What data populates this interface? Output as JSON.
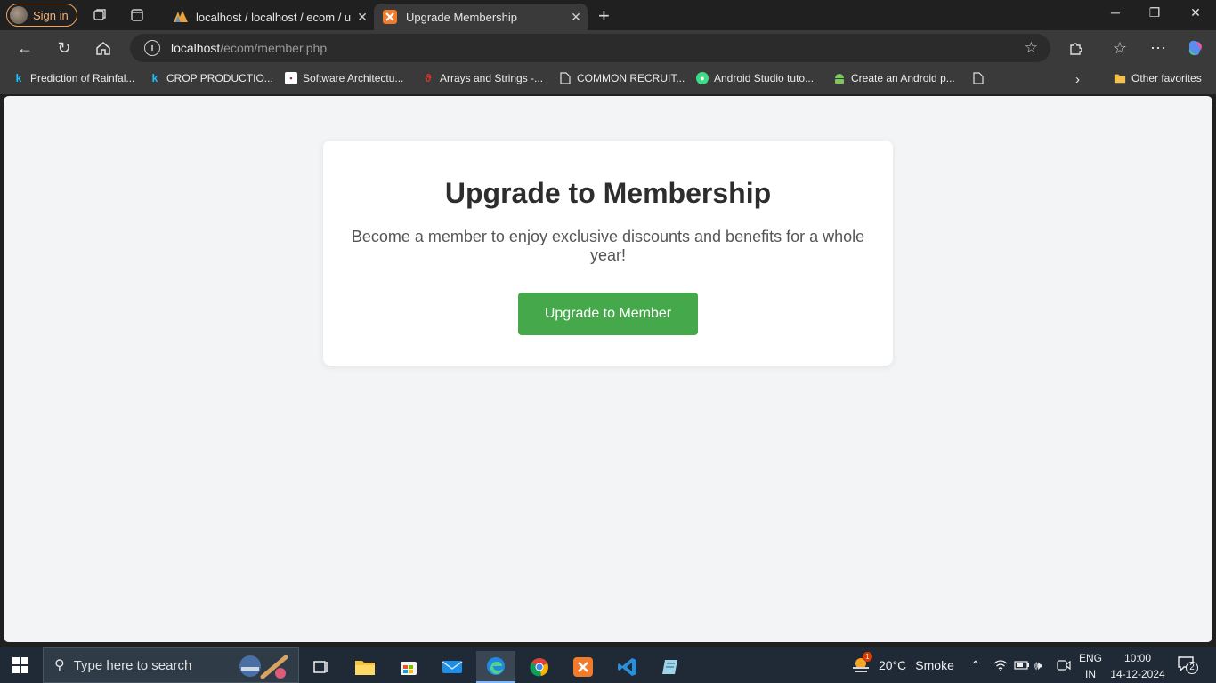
{
  "browser": {
    "signin_label": "Sign in",
    "tabs": [
      {
        "title": "localhost / localhost / ecom / users",
        "active": false
      },
      {
        "title": "Upgrade Membership",
        "active": true
      }
    ],
    "url_host": "localhost",
    "url_path": "/ecom/member.php",
    "favorites": [
      {
        "label": "Prediction of Rainfal...",
        "icon": "kaggle-icon"
      },
      {
        "label": "CROP PRODUCTIO...",
        "icon": "kaggle-icon"
      },
      {
        "label": "Software Architectu...",
        "icon": "site-icon"
      },
      {
        "label": "Arrays and Strings -...",
        "icon": "site-icon"
      },
      {
        "label": "COMMON RECRUIT...",
        "icon": "document-icon"
      },
      {
        "label": "Android Studio tuto...",
        "icon": "android-studio-icon"
      },
      {
        "label": "Create an Android p...",
        "icon": "android-icon"
      }
    ],
    "other_favorites": "Other favorites"
  },
  "page": {
    "heading": "Upgrade to Membership",
    "description": "Become a member to enjoy exclusive discounts and benefits for a whole year!",
    "button_label": "Upgrade to Member"
  },
  "taskbar": {
    "search_placeholder": "Type here to search",
    "weather_temp": "20°C",
    "weather_desc": "Smoke",
    "weather_badge": "1",
    "lang_top": "ENG",
    "lang_bottom": "IN",
    "time": "10:00",
    "date": "14-12-2024",
    "notification_count": "2"
  },
  "colors": {
    "accent_button": "#45a84a",
    "page_bg": "#f3f4f6"
  }
}
